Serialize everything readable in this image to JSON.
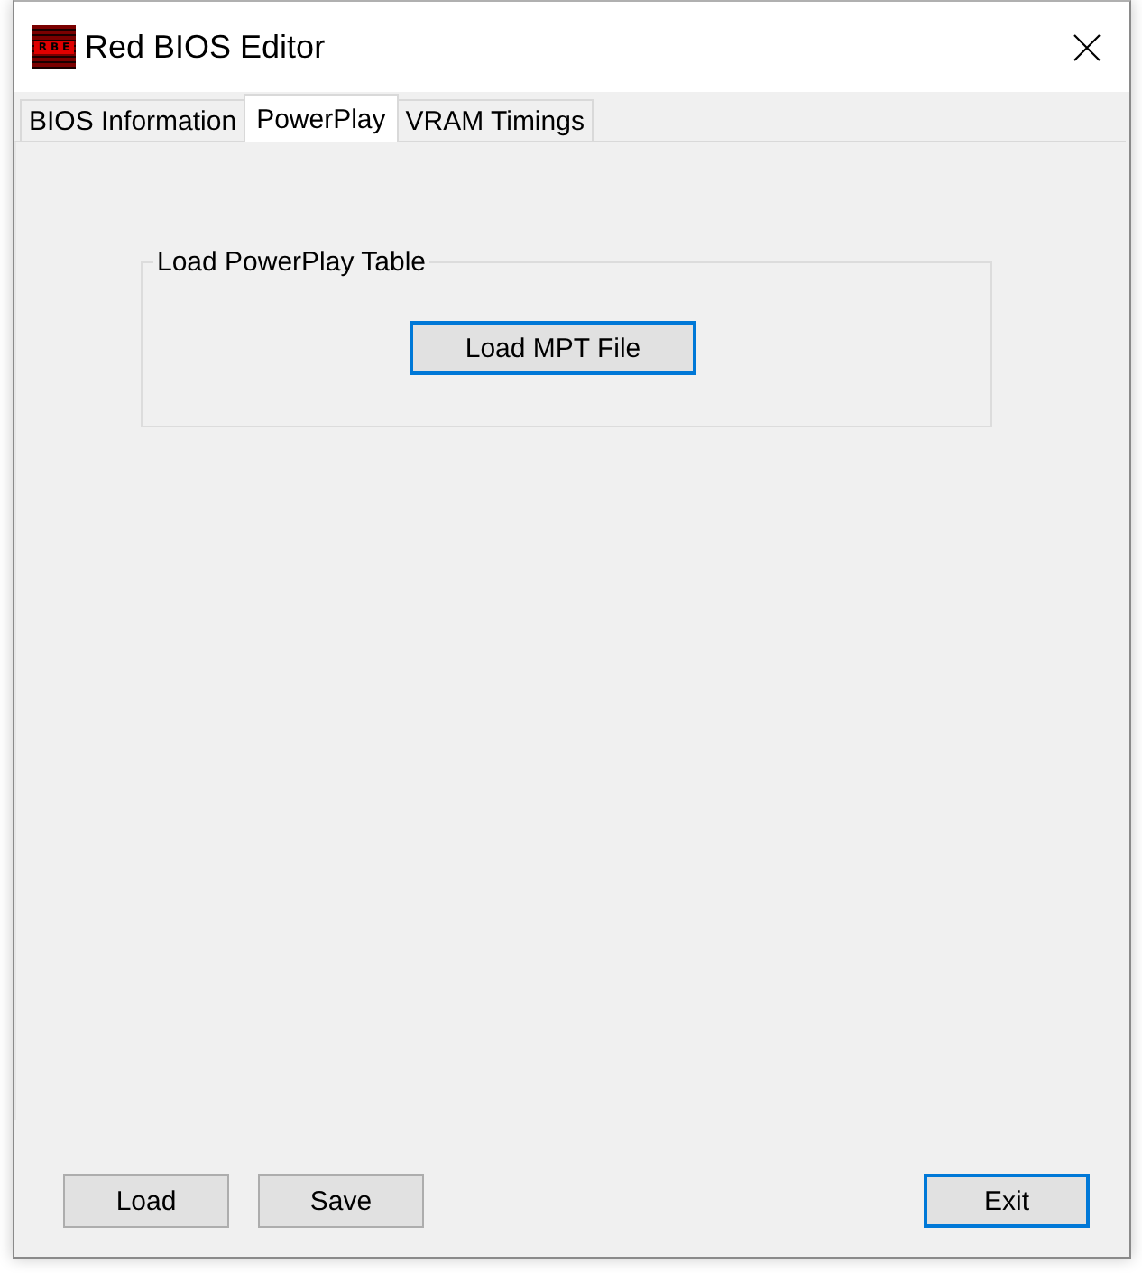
{
  "window": {
    "title": "Red BIOS Editor",
    "logo_text": "RBE"
  },
  "tabs": [
    {
      "label": "BIOS Information",
      "selected": false
    },
    {
      "label": "PowerPlay",
      "selected": true
    },
    {
      "label": "VRAM Timings",
      "selected": false
    }
  ],
  "powerplay_group": {
    "title": "Load PowerPlay Table",
    "button": {
      "label": "Load MPT File",
      "default": true
    }
  },
  "buttons": [
    {
      "label": "Load",
      "default": false
    },
    {
      "label": "Save",
      "default": false
    },
    {
      "label": "Exit",
      "default": true
    }
  ]
}
